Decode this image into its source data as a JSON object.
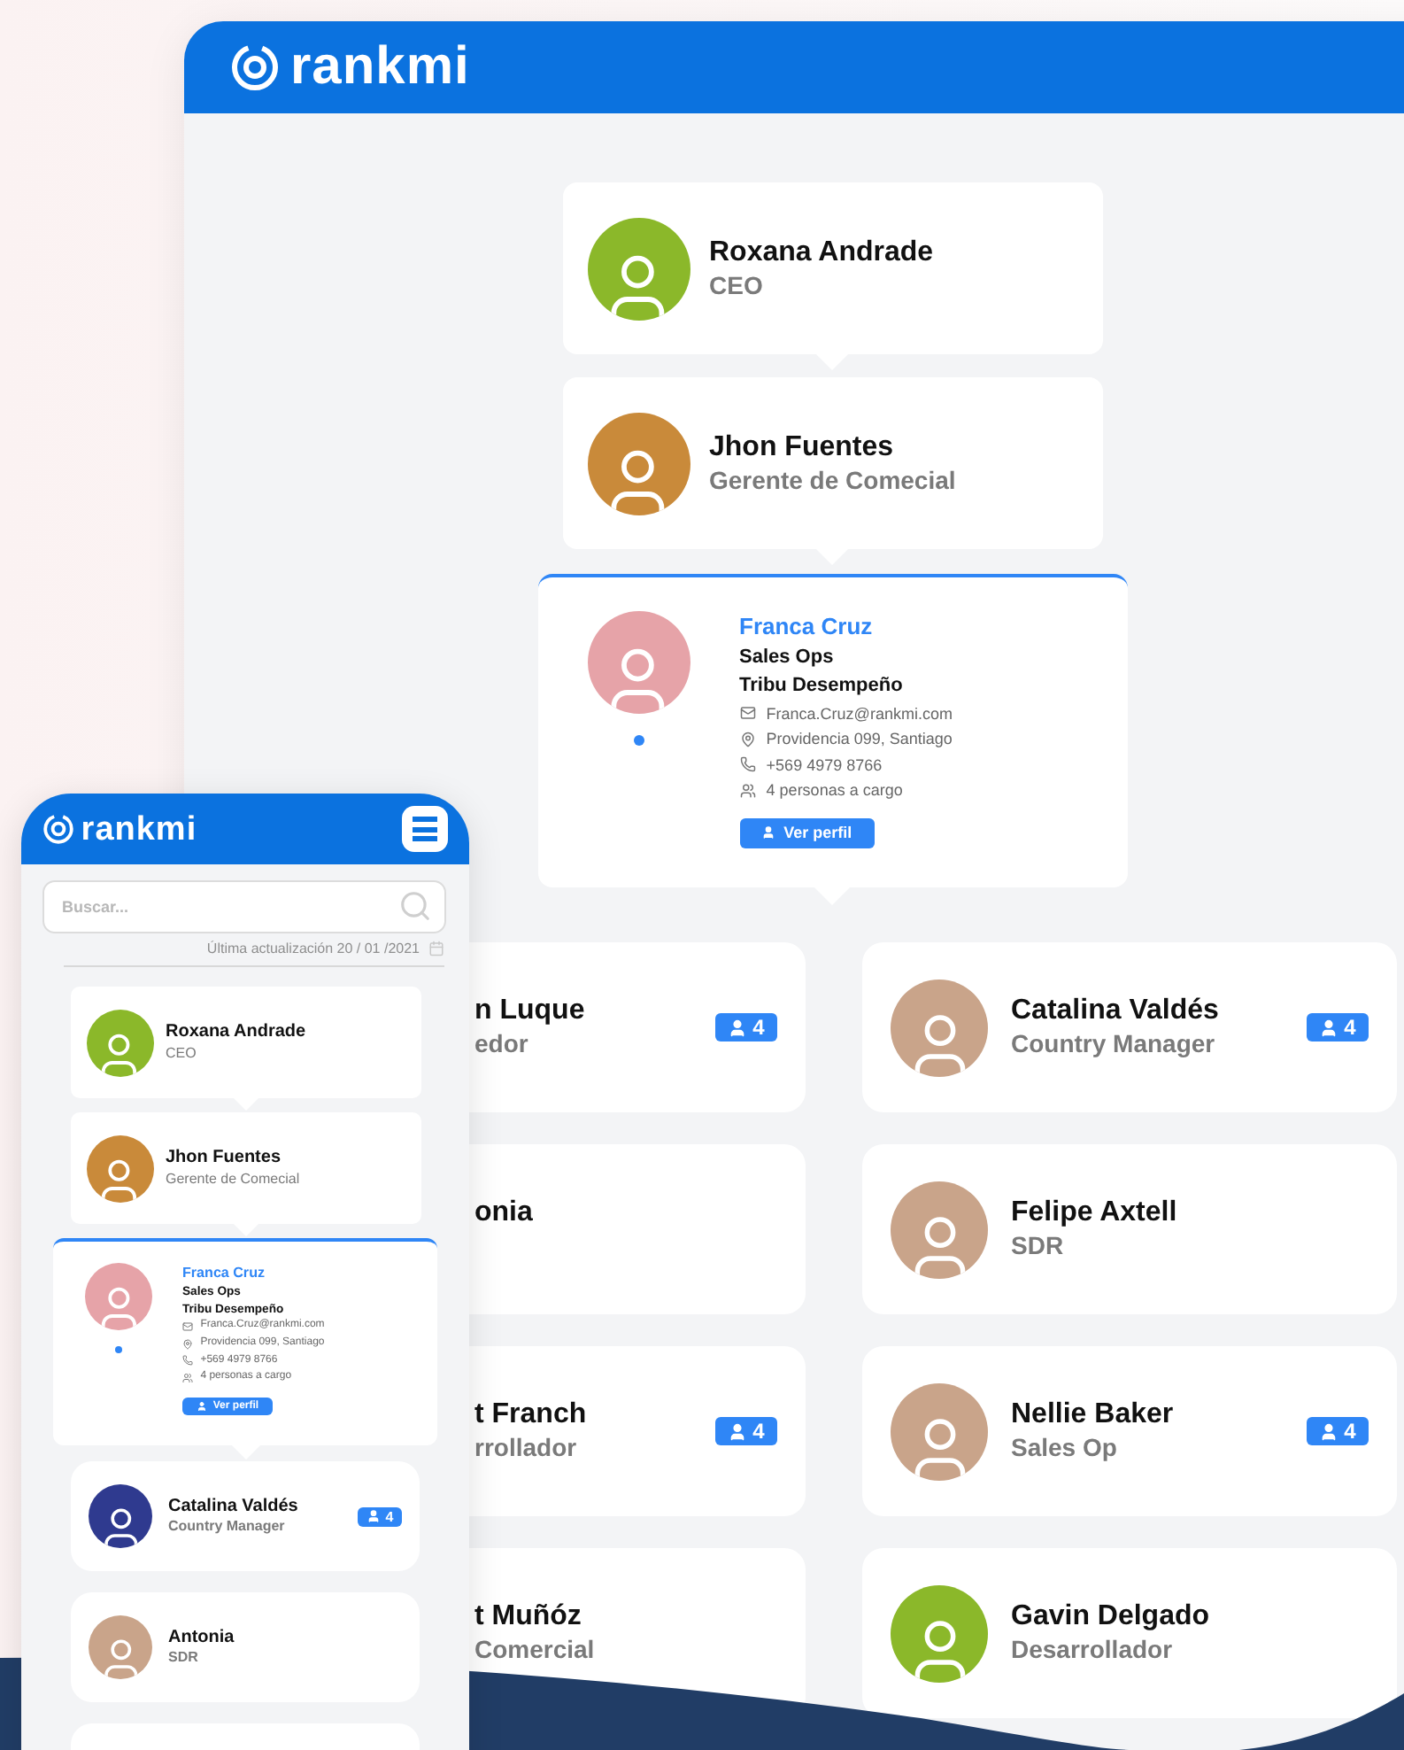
{
  "desktop": {
    "logo": "rankmi",
    "chain": [
      {
        "name": "Roxana Andrade",
        "role": "CEO"
      },
      {
        "name": "Jhon Fuentes",
        "role": "Gerente de Comecial"
      }
    ],
    "focus": {
      "name": "Franca Cruz",
      "role": "Sales Ops",
      "team": "Tribu Desempeño",
      "contacts": [
        {
          "kind": "email",
          "text": "Franca.Cruz@rankmi.com"
        },
        {
          "kind": "location",
          "text": "Providencia 099, Santiago"
        },
        {
          "kind": "phone",
          "text": "+569 4979 8766"
        },
        {
          "kind": "people",
          "text": "4 personas a cargo"
        }
      ],
      "button": "Ver perfil"
    },
    "team": [
      {
        "kind": "clipped",
        "name": "n Luque",
        "role": "edor",
        "reports": "4"
      },
      {
        "kind": "full",
        "name": "Catalina Valdés",
        "role": "Country Manager",
        "reports": "4"
      },
      {
        "kind": "clipped",
        "name": "onia"
      },
      {
        "kind": "full",
        "name": "Felipe Axtell",
        "role": "SDR"
      },
      {
        "kind": "clipped",
        "name": "t Franch",
        "role": "rrollador",
        "reports": "4"
      },
      {
        "kind": "full",
        "name": "Nellie Baker",
        "role": "Sales Op",
        "reports": "4"
      },
      {
        "kind": "clipped",
        "name": "t Muñóz",
        "role": "Comercial"
      },
      {
        "kind": "full",
        "name": "Gavin Delgado",
        "role": "Desarrollador"
      }
    ]
  },
  "mobile": {
    "logo": "rankmi",
    "search": {
      "placeholder": "Buscar..."
    },
    "updated": "Última actualización 20 / 01 /2021",
    "chain": [
      {
        "name": "Roxana Andrade",
        "role": "CEO"
      },
      {
        "name": "Jhon Fuentes",
        "role": "Gerente de Comecial"
      }
    ],
    "focus": {
      "name": "Franca Cruz",
      "role": "Sales Ops",
      "team": "Tribu Desempeño",
      "contacts": [
        {
          "kind": "email",
          "text": "Franca.Cruz@rankmi.com"
        },
        {
          "kind": "location",
          "text": "Providencia 099, Santiago"
        },
        {
          "kind": "phone",
          "text": "+569 4979 8766"
        },
        {
          "kind": "people",
          "text": "4 personas a cargo"
        }
      ],
      "button": "Ver perfil"
    },
    "team": [
      {
        "name": "Catalina Valdés",
        "role": "Country Manager",
        "reports": "4"
      },
      {
        "name": "Antonia",
        "role": "SDR"
      }
    ]
  }
}
